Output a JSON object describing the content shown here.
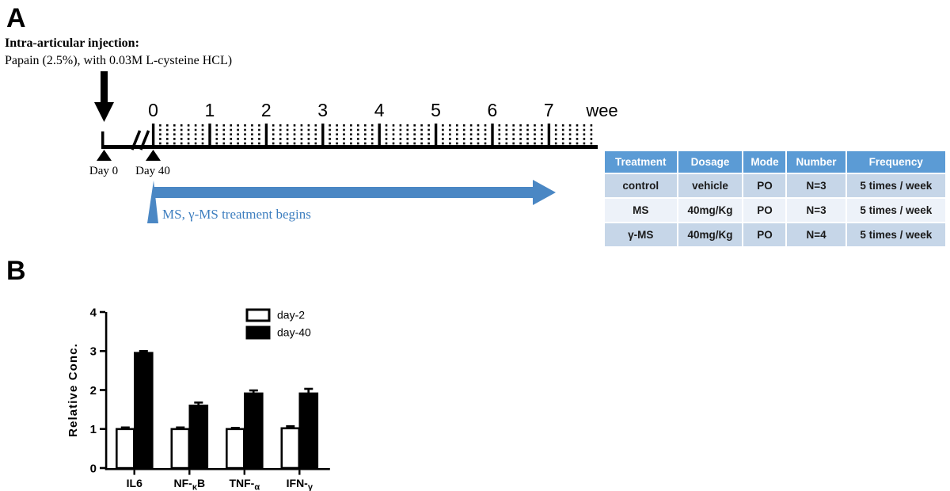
{
  "figure": {
    "panel_a_letter": "A",
    "panel_b_letter": "B"
  },
  "panel_a": {
    "injection": {
      "title": "Intra-articular injection:",
      "detail": "Papain (2.5%), with 0.03M L-cysteine HCL)"
    },
    "timeline": {
      "axis_unit_label": "week",
      "week_ticks": [
        "0",
        "1",
        "2",
        "3",
        "4",
        "5",
        "6",
        "7"
      ],
      "minor_ticks_per_week": 7,
      "day_markers": [
        {
          "label": "Day 0"
        },
        {
          "label": "Day 40"
        }
      ],
      "break_symbol": "//"
    },
    "treatment_arrow": {
      "caption": "MS, γ-MS treatment begins",
      "color": "#4a87c4",
      "caption_color": "#3d7ebf"
    },
    "table": {
      "header_color": "#5b9bd5",
      "row_shade_color": "#c6d6e8",
      "row_light_color": "#edf2f9",
      "columns": [
        "Treatment",
        "Dosage",
        "Mode",
        "Number",
        "Frequency"
      ],
      "rows": [
        [
          "control",
          "vehicle",
          "PO",
          "N=3",
          "5 times / week"
        ],
        [
          "MS",
          "40mg/Kg",
          "PO",
          "N=3",
          "5 times / week"
        ],
        [
          "γ-MS",
          "40mg/Kg",
          "PO",
          "N=4",
          "5 times / week"
        ]
      ]
    }
  },
  "chart_data": {
    "type": "bar",
    "title": "",
    "xlabel": "",
    "ylabel": "Relative Conc.",
    "ylim": [
      0,
      4
    ],
    "ytick_labels": [
      "0",
      "1",
      "2",
      "3",
      "4"
    ],
    "ytick_values": [
      0,
      1,
      2,
      3,
      4
    ],
    "grid": false,
    "legend_position": "top-right",
    "categories": [
      "IL6",
      "NF-κB",
      "TNF-α",
      "IFN-γ"
    ],
    "category_parts": [
      {
        "main": "IL6",
        "sub": ""
      },
      {
        "main": "NF-",
        "sub": "κ",
        "tail": "B"
      },
      {
        "main": "TNF-",
        "sub": "α",
        "tail": ""
      },
      {
        "main": "IFN-",
        "sub": "γ",
        "tail": ""
      }
    ],
    "series": [
      {
        "name": "day-2",
        "fill": "#ffffff",
        "stroke": "#000000",
        "values": [
          1.0,
          1.0,
          1.0,
          1.02
        ],
        "errors": [
          0.04,
          0.04,
          0.03,
          0.05
        ]
      },
      {
        "name": "day-40",
        "fill": "#000000",
        "stroke": "#000000",
        "values": [
          2.95,
          1.6,
          1.91,
          1.91
        ],
        "errors": [
          0.05,
          0.08,
          0.08,
          0.12
        ]
      }
    ]
  }
}
